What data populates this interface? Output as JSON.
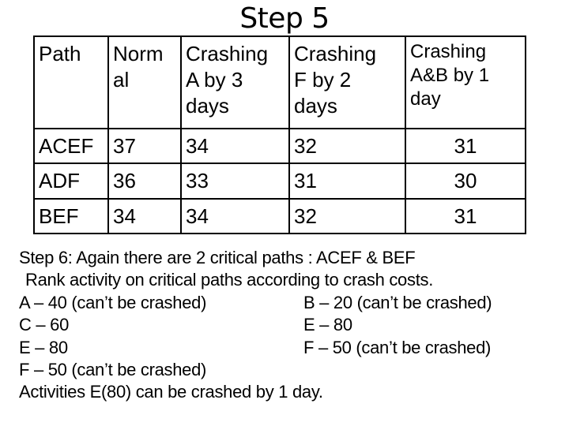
{
  "slide": {
    "title": "Step 5"
  },
  "table": {
    "headers": [
      "Path",
      "Norm al",
      "Crashing A by 3 days",
      "Crashing F by 2 days",
      "Crashing A&B by 1 day"
    ],
    "header_lines": [
      [
        "Path"
      ],
      [
        "Norm",
        "al"
      ],
      [
        "Crashing",
        "A by 3",
        "days"
      ],
      [
        "Crashing",
        "F by 2",
        "days"
      ],
      [
        "Crashing",
        "A&B by 1",
        "day"
      ]
    ],
    "rows": [
      [
        "ACEF",
        "37",
        "34",
        "32",
        "31"
      ],
      [
        "ADF",
        "36",
        "33",
        "31",
        "30"
      ],
      [
        "BEF",
        "34",
        "34",
        "32",
        "31"
      ]
    ]
  },
  "notes": {
    "line1": "Step 6: Again there are 2 critical paths : ACEF & BEF",
    "line2": "Rank activity on critical paths according to crash costs.",
    "left_list": [
      "A – 40 (can’t be crashed)",
      "C – 60",
      "E – 80",
      "F – 50 (can’t be crashed)"
    ],
    "right_list": [
      "B – 20 (can’t be crashed)",
      "E – 80",
      "F – 50 (can’t be crashed)"
    ],
    "conclusion": "Activities E(80) can be crashed by 1 day."
  }
}
